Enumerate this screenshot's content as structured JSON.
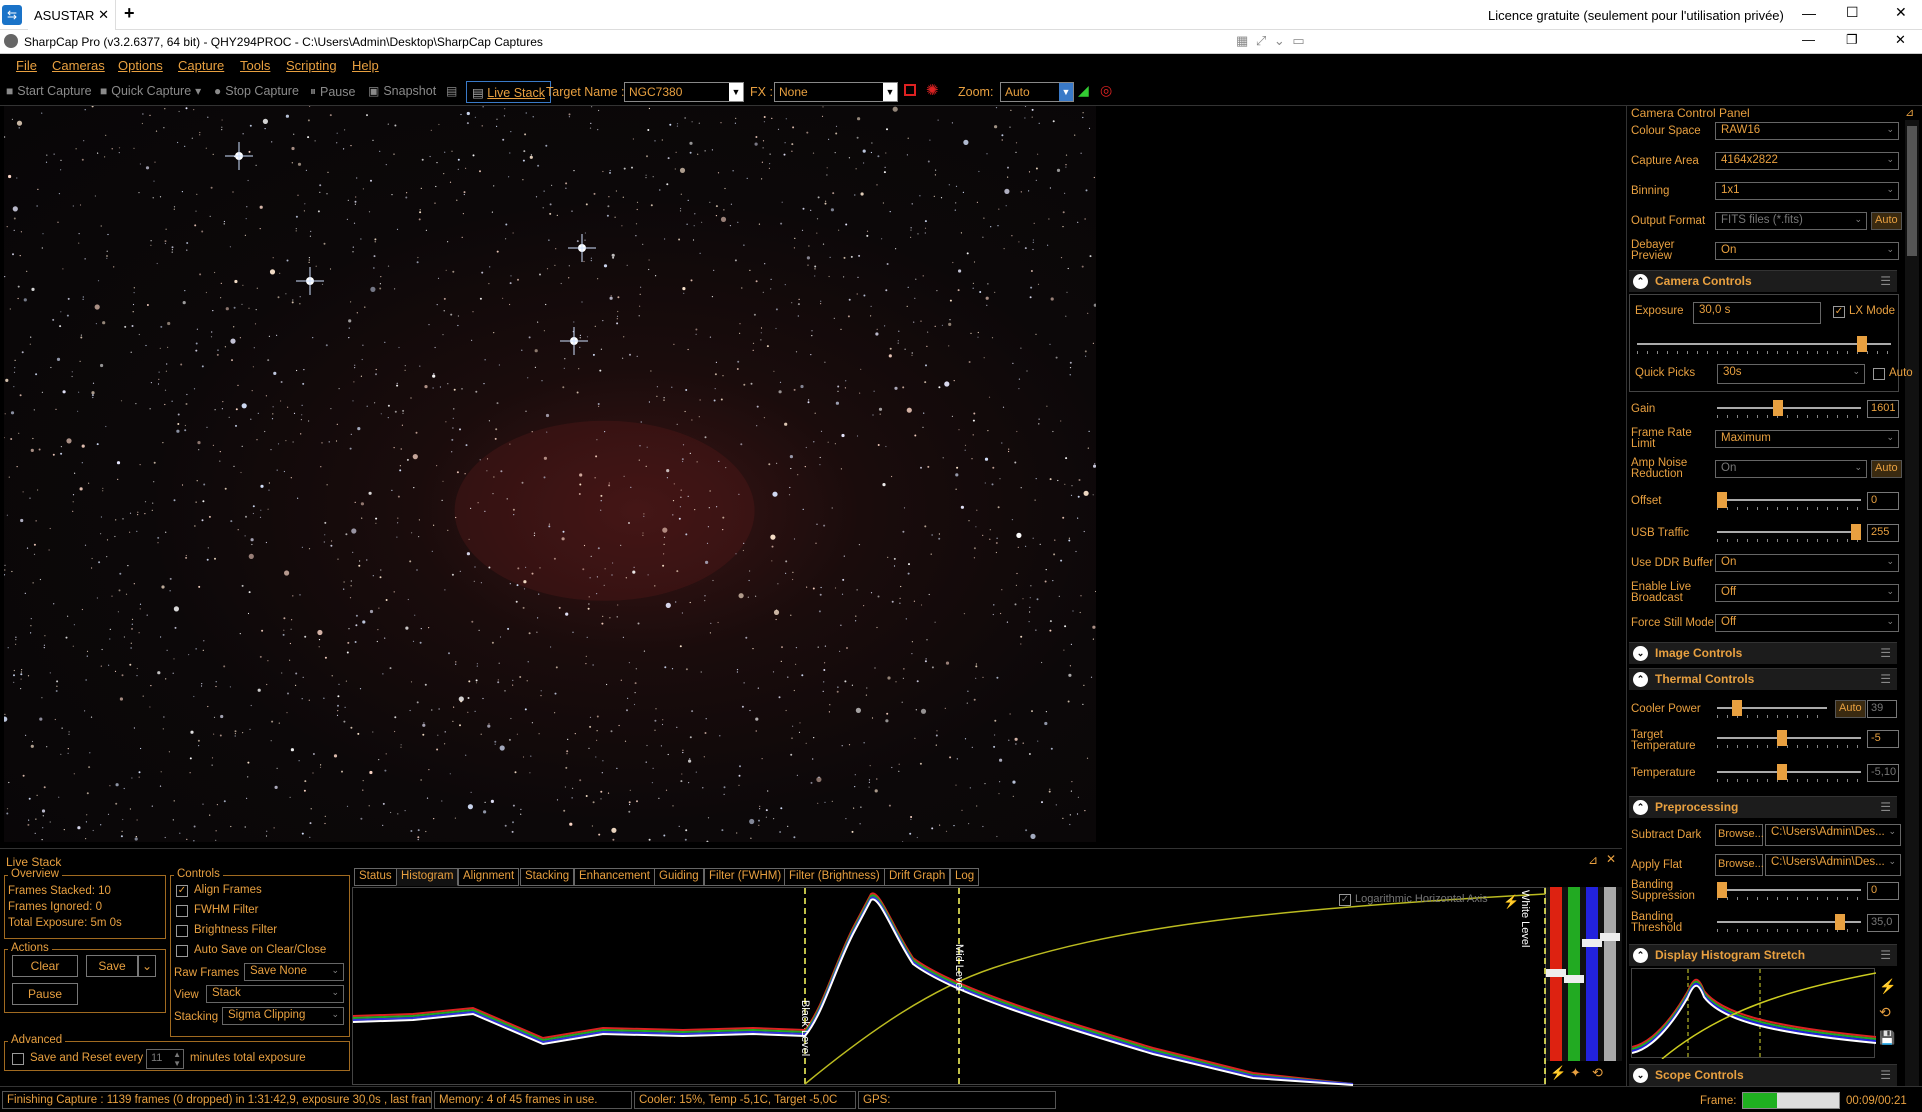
{
  "tabbar": {
    "tab_label": "ASUSTAR",
    "new_tab": "+",
    "licence_text": "Licence gratuite (seulement pour l'utilisation privée)"
  },
  "titlebar": {
    "title": "SharpCap Pro (v3.2.6377, 64 bit) - QHY294PROC - C:\\Users\\Admin\\Desktop\\SharpCap Captures"
  },
  "menu": [
    "File",
    "Cameras",
    "Options",
    "Capture",
    "Tools",
    "Scripting",
    "Help"
  ],
  "toolbar": {
    "start_capture": "Start Capture",
    "quick_capture": "Quick Capture",
    "stop_capture": "Stop Capture",
    "pause": "Pause",
    "snapshot": "Snapshot",
    "live_stack": "Live Stack",
    "target_name_label": "Target Name :",
    "target_name_value": "NGC7380",
    "fx_label": "FX :",
    "fx_value": "None",
    "zoom_label": "Zoom:",
    "zoom_value": "Auto"
  },
  "camera_panel": {
    "title": "Camera Control Panel",
    "colour_space_label": "Colour Space",
    "colour_space_value": "RAW16",
    "capture_area_label": "Capture Area",
    "capture_area_value": "4164x2822",
    "binning_label": "Binning",
    "binning_value": "1x1",
    "output_format_label": "Output Format",
    "output_format_value": "FITS files (*.fits)",
    "output_format_auto": "Auto",
    "debayer_label_1": "Debayer",
    "debayer_label_2": "Preview",
    "debayer_value": "On",
    "camera_controls_title": "Camera Controls",
    "exposure_label": "Exposure",
    "exposure_value": "30,0 s",
    "lx_mode_label": "LX Mode",
    "quick_picks_label": "Quick Picks",
    "quick_picks_value": "30s",
    "quick_picks_auto": "Auto",
    "gain_label": "Gain",
    "gain_value": "1601",
    "frame_rate_label_1": "Frame Rate",
    "frame_rate_label_2": "Limit",
    "frame_rate_value": "Maximum",
    "amp_noise_label_1": "Amp Noise",
    "amp_noise_label_2": "Reduction",
    "amp_noise_value": "On",
    "amp_noise_auto": "Auto",
    "offset_label": "Offset",
    "offset_value": "0",
    "usb_traffic_label": "USB Traffic",
    "usb_traffic_value": "255",
    "ddr_buffer_label": "Use DDR Buffer",
    "ddr_buffer_value": "On",
    "live_broadcast_label_1": "Enable Live",
    "live_broadcast_label_2": "Broadcast",
    "live_broadcast_value": "Off",
    "force_still_label": "Force Still Mode",
    "force_still_value": "Off",
    "image_controls_title": "Image Controls",
    "thermal_controls_title": "Thermal Controls",
    "cooler_power_label": "Cooler Power",
    "cooler_power_auto": "Auto",
    "cooler_power_value": "39",
    "target_temp_label_1": "Target",
    "target_temp_label_2": "Temperature",
    "target_temp_value": "-5",
    "temperature_label": "Temperature",
    "temperature_value": "-5,10",
    "preprocessing_title": "Preprocessing",
    "subtract_dark_label": "Subtract Dark",
    "subtract_dark_browse": "Browse...",
    "subtract_dark_path": "C:\\Users\\Admin\\Des...",
    "apply_flat_label": "Apply Flat",
    "apply_flat_browse": "Browse...",
    "apply_flat_path": "C:\\Users\\Admin\\Des...",
    "banding_supp_label_1": "Banding",
    "banding_supp_label_2": "Suppression",
    "banding_supp_value": "0",
    "banding_thresh_label_1": "Banding",
    "banding_thresh_label_2": "Threshold",
    "banding_thresh_value": "35,0",
    "display_histogram_title": "Display Histogram Stretch",
    "scope_controls_title": "Scope Controls"
  },
  "slider_levels": {
    "exposure": 0.9,
    "gain": 0.42,
    "offset": 0.0,
    "usb_traffic": 1.0,
    "cooler_power": 0.15,
    "target_temp": 0.45,
    "temperature": 0.45,
    "banding_suppression": 0.0,
    "banding_threshold": 0.88
  },
  "live_stack": {
    "title": "Live Stack",
    "overview_title": "Overview",
    "frames_stacked": "Frames Stacked:  10",
    "frames_ignored": "Frames Ignored:   0",
    "total_exposure": "Total Exposure:   5m 0s",
    "actions_title": "Actions",
    "clear": "Clear",
    "save": "Save",
    "pause": "Pause",
    "advanced_title": "Advanced",
    "save_reset_label": "Save and Reset every",
    "save_reset_value": "11",
    "save_reset_suffix": "minutes total exposure",
    "controls_title": "Controls",
    "align_frames": "Align Frames",
    "fwhm_filter": "FWHM Filter",
    "brightness_filter": "Brightness Filter",
    "auto_save": "Auto Save on Clear/Close",
    "raw_frames_label": "Raw Frames",
    "raw_frames_value": "Save None",
    "view_label": "View",
    "view_value": "Stack",
    "stacking_label": "Stacking",
    "stacking_value": "Sigma Clipping",
    "tabs": [
      "Status",
      "Histogram",
      "Alignment",
      "Stacking",
      "Enhancement",
      "Guiding",
      "Filter (FWHM)",
      "Filter (Brightness)",
      "Drift Graph",
      "Log"
    ],
    "log_axis_label": "Logarithmic Horizontal Axis",
    "black_level": "Black Level",
    "mid_level": "Mid Level",
    "white_level": "White Level"
  },
  "statusbar": {
    "capture_status": "Finishing Capture : 1139 frames (0 dropped) in 1:31:42,9, exposure 30,0s , last fran",
    "memory": "Memory: 4 of 45 frames in use.",
    "cooler": "Cooler: 15%, Temp -5,1C, Target -5,0C",
    "gps": "GPS:",
    "frame_label": "Frame:",
    "frame_progress": 0.35,
    "frame_time": "00:09/00:21"
  },
  "colors": {
    "accent": "#e8a040",
    "progress_green": "#1fb020"
  }
}
